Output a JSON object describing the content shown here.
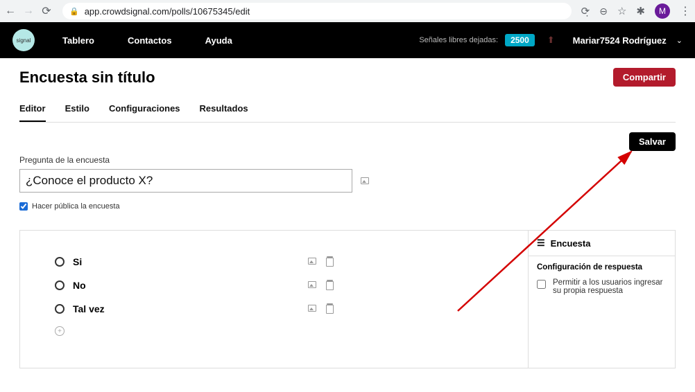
{
  "browser": {
    "url": "app.crowdsignal.com/polls/10675345/edit",
    "avatar_letter": "M"
  },
  "appbar": {
    "nav": [
      "Tablero",
      "Contactos",
      "Ayuda"
    ],
    "signals_label": "Señales libres dejadas:",
    "signals_count": "2500",
    "user": "Mariar7524 Rodríguez"
  },
  "page": {
    "title": "Encuesta sin título",
    "share_label": "Compartir",
    "tabs": [
      "Editor",
      "Estilo",
      "Configuraciones",
      "Resultados"
    ],
    "active_tab": 0,
    "save_label": "Salvar",
    "question_label": "Pregunta de la encuesta",
    "question_value": "¿Conoce el producto X?",
    "make_public_label": "Hacer pública la encuesta",
    "make_public_checked": true
  },
  "answers": {
    "items": [
      {
        "label": "Si"
      },
      {
        "label": "No"
      },
      {
        "label": "Tal vez"
      }
    ]
  },
  "sidepanel": {
    "header": "Encuesta",
    "section_title": "Configuración de respuesta",
    "allow_own_label": "Permitir a los usuarios ingresar su propia respuesta",
    "allow_own_checked": false
  }
}
